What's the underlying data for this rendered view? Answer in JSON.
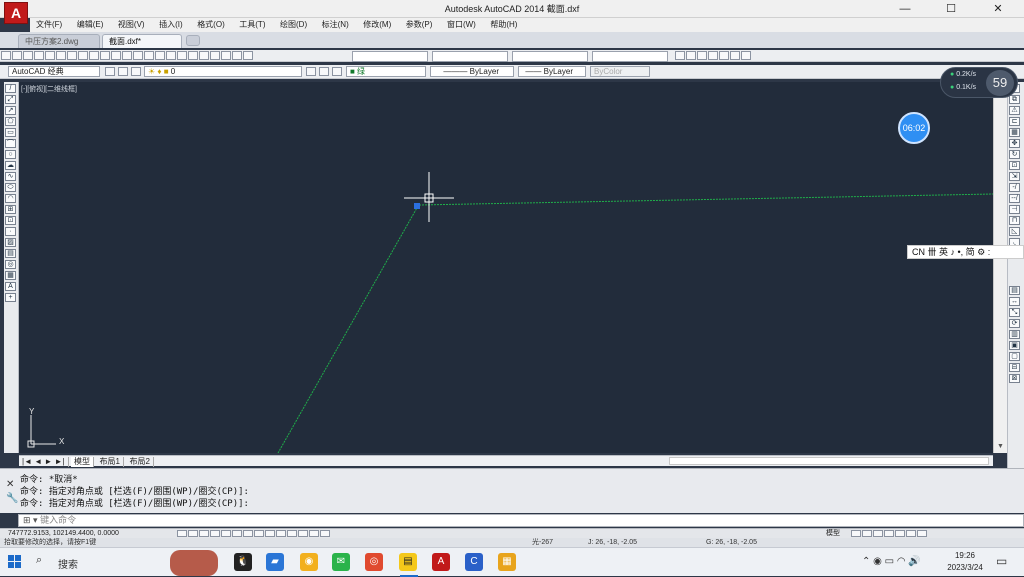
{
  "window": {
    "title": "Autodesk AutoCAD 2014    截面.dxf",
    "logo": "A",
    "minimize": "—",
    "maximize": "☐",
    "close": "✕"
  },
  "menu": [
    "文件(F)",
    "编辑(E)",
    "视图(V)",
    "插入(I)",
    "格式(O)",
    "工具(T)",
    "绘图(D)",
    "标注(N)",
    "修改(M)",
    "参数(P)",
    "窗口(W)",
    "帮助(H)"
  ],
  "doc_tabs": [
    {
      "label": "中压方案2.dwg"
    },
    {
      "label": "截面.dxf*"
    }
  ],
  "toolbar": {
    "workspace": "AutoCAD 经典",
    "layer": "0",
    "color": "■ 绿",
    "linetype": "ByLayer",
    "lineweight": "ByLayer",
    "plotstyle": "ByColor"
  },
  "viewport_label": "[-][俯视][二维线框]",
  "ucs": {
    "y": "Y",
    "x": "X"
  },
  "layout_tabs": {
    "nav": "|◄ ◄ ► ►|",
    "model": "模型",
    "layout1": "布局1",
    "layout2": "布局2"
  },
  "command_history": [
    "命令: *取消*",
    "命令: 指定对角点或 [栏选(F)/圈围(WP)/圈交(CP)]:",
    "命令: 指定对角点或 [栏选(F)/圈围(WP)/圈交(CP)]:"
  ],
  "command_input_placeholder": "键入命令",
  "status": {
    "coords": "747772.9153, 102149.4400, 0.0000",
    "model": "模型"
  },
  "prompt": {
    "left": "拾取要修改的选择，请按F1键",
    "angle": "光-267",
    "d1": "J: 26, -18, -2.05",
    "d2": "G: 26, -18, -2.05"
  },
  "timer": "06:02",
  "network": {
    "up": "0.2K/s",
    "down": "0.1K/s",
    "percent": "59"
  },
  "ime": "CN 卌 英 ♪ •, 简 ⚙ :",
  "taskbar": {
    "search": "搜索",
    "time": "19:26",
    "date": "2023/3/24"
  },
  "colors": {
    "canvas": "#222c3b",
    "line": "#1fae4a",
    "accent": "#2f8ff3"
  }
}
